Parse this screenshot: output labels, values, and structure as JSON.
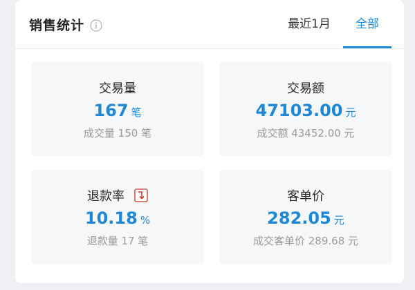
{
  "header": {
    "title": "销售统计",
    "info_icon": "info-icon",
    "tabs": [
      {
        "label": "最近1月",
        "active": false
      },
      {
        "label": "全部",
        "active": true
      }
    ]
  },
  "colors": {
    "accent": "#1e88d6",
    "trend_down": "#c0392b"
  },
  "stats": {
    "transactions": {
      "label": "交易量",
      "value": "167",
      "unit": "笔",
      "sub": "成交量 150 笔"
    },
    "amount": {
      "label": "交易额",
      "value": "47103.00",
      "unit": "元",
      "sub": "成交额 43452.00 元"
    },
    "refund_rate": {
      "label": "退款率",
      "value": "10.18",
      "unit": "%",
      "sub": "退款量 17 笔",
      "trend_icon": "trend-down-icon"
    },
    "avg_order": {
      "label": "客单价",
      "value": "282.05",
      "unit": "元",
      "sub": "成交客单价 289.68 元"
    }
  }
}
